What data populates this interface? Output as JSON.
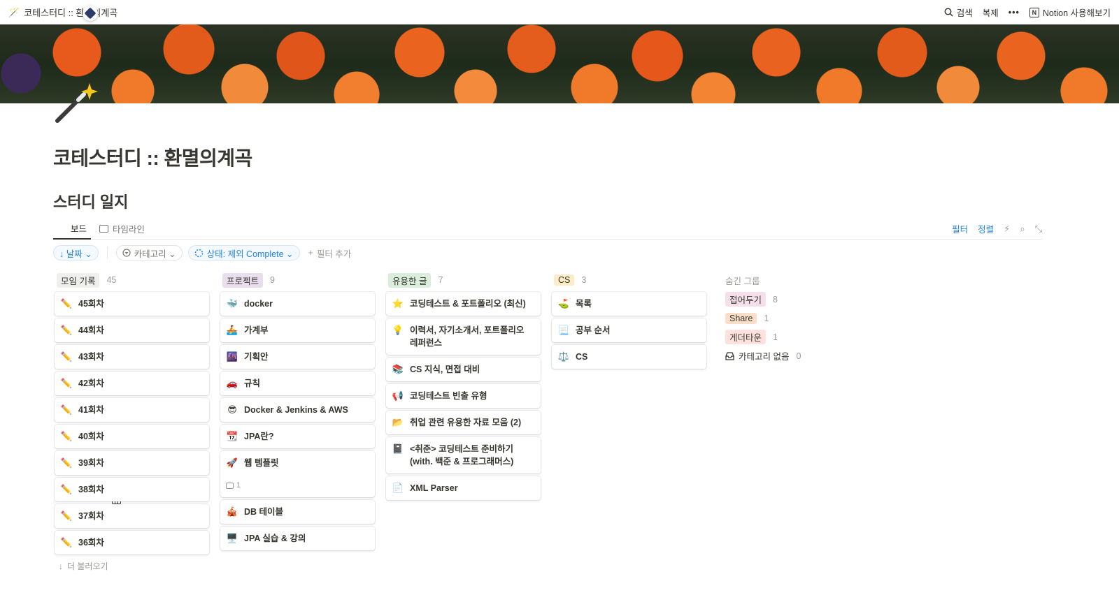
{
  "topbar": {
    "page_emoji": "🪄",
    "breadcrumb": "코테스터디 :: 환멸의계곡",
    "search": "검색",
    "duplicate": "복제",
    "more": "•••",
    "try_notion": "Notion 사용해보기"
  },
  "page": {
    "icon": "magic-wand",
    "title": "코테스터디 :: 환멸의계곡"
  },
  "database": {
    "title": "스터디 일지",
    "tabs": [
      {
        "label": "보드",
        "icon": "board-icon",
        "active": true
      },
      {
        "label": "타임라인",
        "icon": "timeline-icon",
        "active": false
      }
    ],
    "tools": {
      "filter": "필터",
      "sort": "정렬",
      "automation_icon": "⚡",
      "search_icon": "⌕",
      "expand_icon": "⤡"
    },
    "filters": {
      "date": "↓ 날짜 ⌄",
      "category": "카테고리 ⌄",
      "status": "상태: 제외 Complete ⌄",
      "add": "필터 추가"
    }
  },
  "board": {
    "columns": [
      {
        "name": "모임 기록",
        "count": "45",
        "color": "#efefee",
        "cards": [
          {
            "icon": "✏️",
            "title": "45회차"
          },
          {
            "icon": "✏️",
            "title": "44회차"
          },
          {
            "icon": "✏️",
            "title": "43회차"
          },
          {
            "icon": "✏️",
            "title": "42회차"
          },
          {
            "icon": "✏️",
            "title": "41회차"
          },
          {
            "icon": "✏️",
            "title": "40회차"
          },
          {
            "icon": "✏️",
            "title": "39회차"
          },
          {
            "icon": "✏️",
            "title": "38회차"
          },
          {
            "icon": "✏️",
            "title": "37회차"
          },
          {
            "icon": "✏️",
            "title": "36회차"
          }
        ],
        "load_more": "더 불러오기"
      },
      {
        "name": "프로젝트",
        "count": "9",
        "color": "#e8deee",
        "cards": [
          {
            "icon": "🐳",
            "title": "docker"
          },
          {
            "icon": "🚣",
            "title": "가계부"
          },
          {
            "icon": "🌆",
            "title": "기획안"
          },
          {
            "icon": "🚗",
            "title": "규칙"
          },
          {
            "icon": "😎",
            "title": "Docker & Jenkins & AWS"
          },
          {
            "icon": "📆",
            "title": "JPA란?"
          },
          {
            "icon": "🚀",
            "title": "웹 템플릿",
            "comments": "1"
          },
          {
            "icon": "🎪",
            "title": "DB 테이블"
          },
          {
            "icon": "🖥️",
            "title": "JPA 실습 & 강의"
          }
        ]
      },
      {
        "name": "유용한 글",
        "count": "7",
        "color": "#dbeddb",
        "cards": [
          {
            "icon": "⭐",
            "title": "코딩테스트 & 포트폴리오 (최신)"
          },
          {
            "icon": "💡",
            "title": "이력서, 자기소개서, 포트폴리오 레퍼런스"
          },
          {
            "icon": "📚",
            "title": "CS 지식, 면접 대비"
          },
          {
            "icon": "📢",
            "title": "코딩테스트 빈출 유형"
          },
          {
            "icon": "📂",
            "title": "취업 관련 유용한 자료 모음 (2)"
          },
          {
            "icon": "📓",
            "title": "<취준> 코딩테스트 준비하기 (with. 백준 & 프로그래머스)"
          },
          {
            "icon": "📄",
            "title": "XML Parser"
          }
        ]
      },
      {
        "name": "CS",
        "count": "3",
        "color": "#fdecc8",
        "cards": [
          {
            "icon": "⛳",
            "title": "목록"
          },
          {
            "icon": "📃",
            "title": "공부 순서"
          },
          {
            "icon": "⚖️",
            "title": "CS"
          }
        ]
      }
    ],
    "hidden_groups": {
      "title": "숨긴 그룹",
      "items": [
        {
          "name": "접어두기",
          "count": "8",
          "color": "#f4dfeb"
        },
        {
          "name": "Share",
          "count": "1",
          "color": "#fadec9"
        },
        {
          "name": "게더타운",
          "count": "1",
          "color": "#ffe2dd"
        },
        {
          "name": "카테고리 없음",
          "count": "0",
          "icon": "inbox-icon"
        }
      ]
    }
  }
}
